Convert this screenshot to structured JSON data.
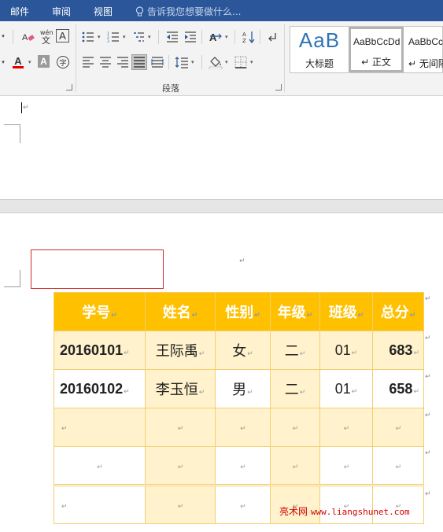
{
  "tabs": [
    "邮件",
    "审阅",
    "视图"
  ],
  "tell_me": "告诉我您想要做什么...",
  "ribbon": {
    "clear_format": "清除格式",
    "pinyin": "wén 文",
    "char_border": "A",
    "font_color": "A",
    "char_shading": "A",
    "enclose_char": "字",
    "group_label": "段落"
  },
  "styles": [
    {
      "sample": "AaB",
      "name": "大标题"
    },
    {
      "sample": "AaBbCcDd",
      "name": "↵ 正文"
    },
    {
      "sample": "AaBbCcDd",
      "name": "↵ 无间隔"
    }
  ],
  "paragraph_mark": "↵",
  "table": {
    "headers": [
      "学号",
      "姓名",
      "性别",
      "年级",
      "班级",
      "总分"
    ],
    "rows": [
      [
        "20160101",
        "王际禹",
        "女",
        "二",
        "01",
        "683"
      ],
      [
        "20160102",
        "李玉恒",
        "男",
        "二",
        "01",
        "658"
      ],
      [
        "",
        "",
        "",
        "",
        "",
        ""
      ],
      [
        "",
        "",
        "",
        "",
        "",
        ""
      ],
      [
        "",
        "",
        "",
        "",
        "",
        ""
      ]
    ]
  },
  "watermark": {
    "cn": "亮术网",
    "url": "www.liangshunet.com"
  },
  "colors": {
    "accent": "#2b579a",
    "header_fill": "#ffc000",
    "band_fill": "#fff2cc",
    "font_color_bar": "#e00000"
  }
}
